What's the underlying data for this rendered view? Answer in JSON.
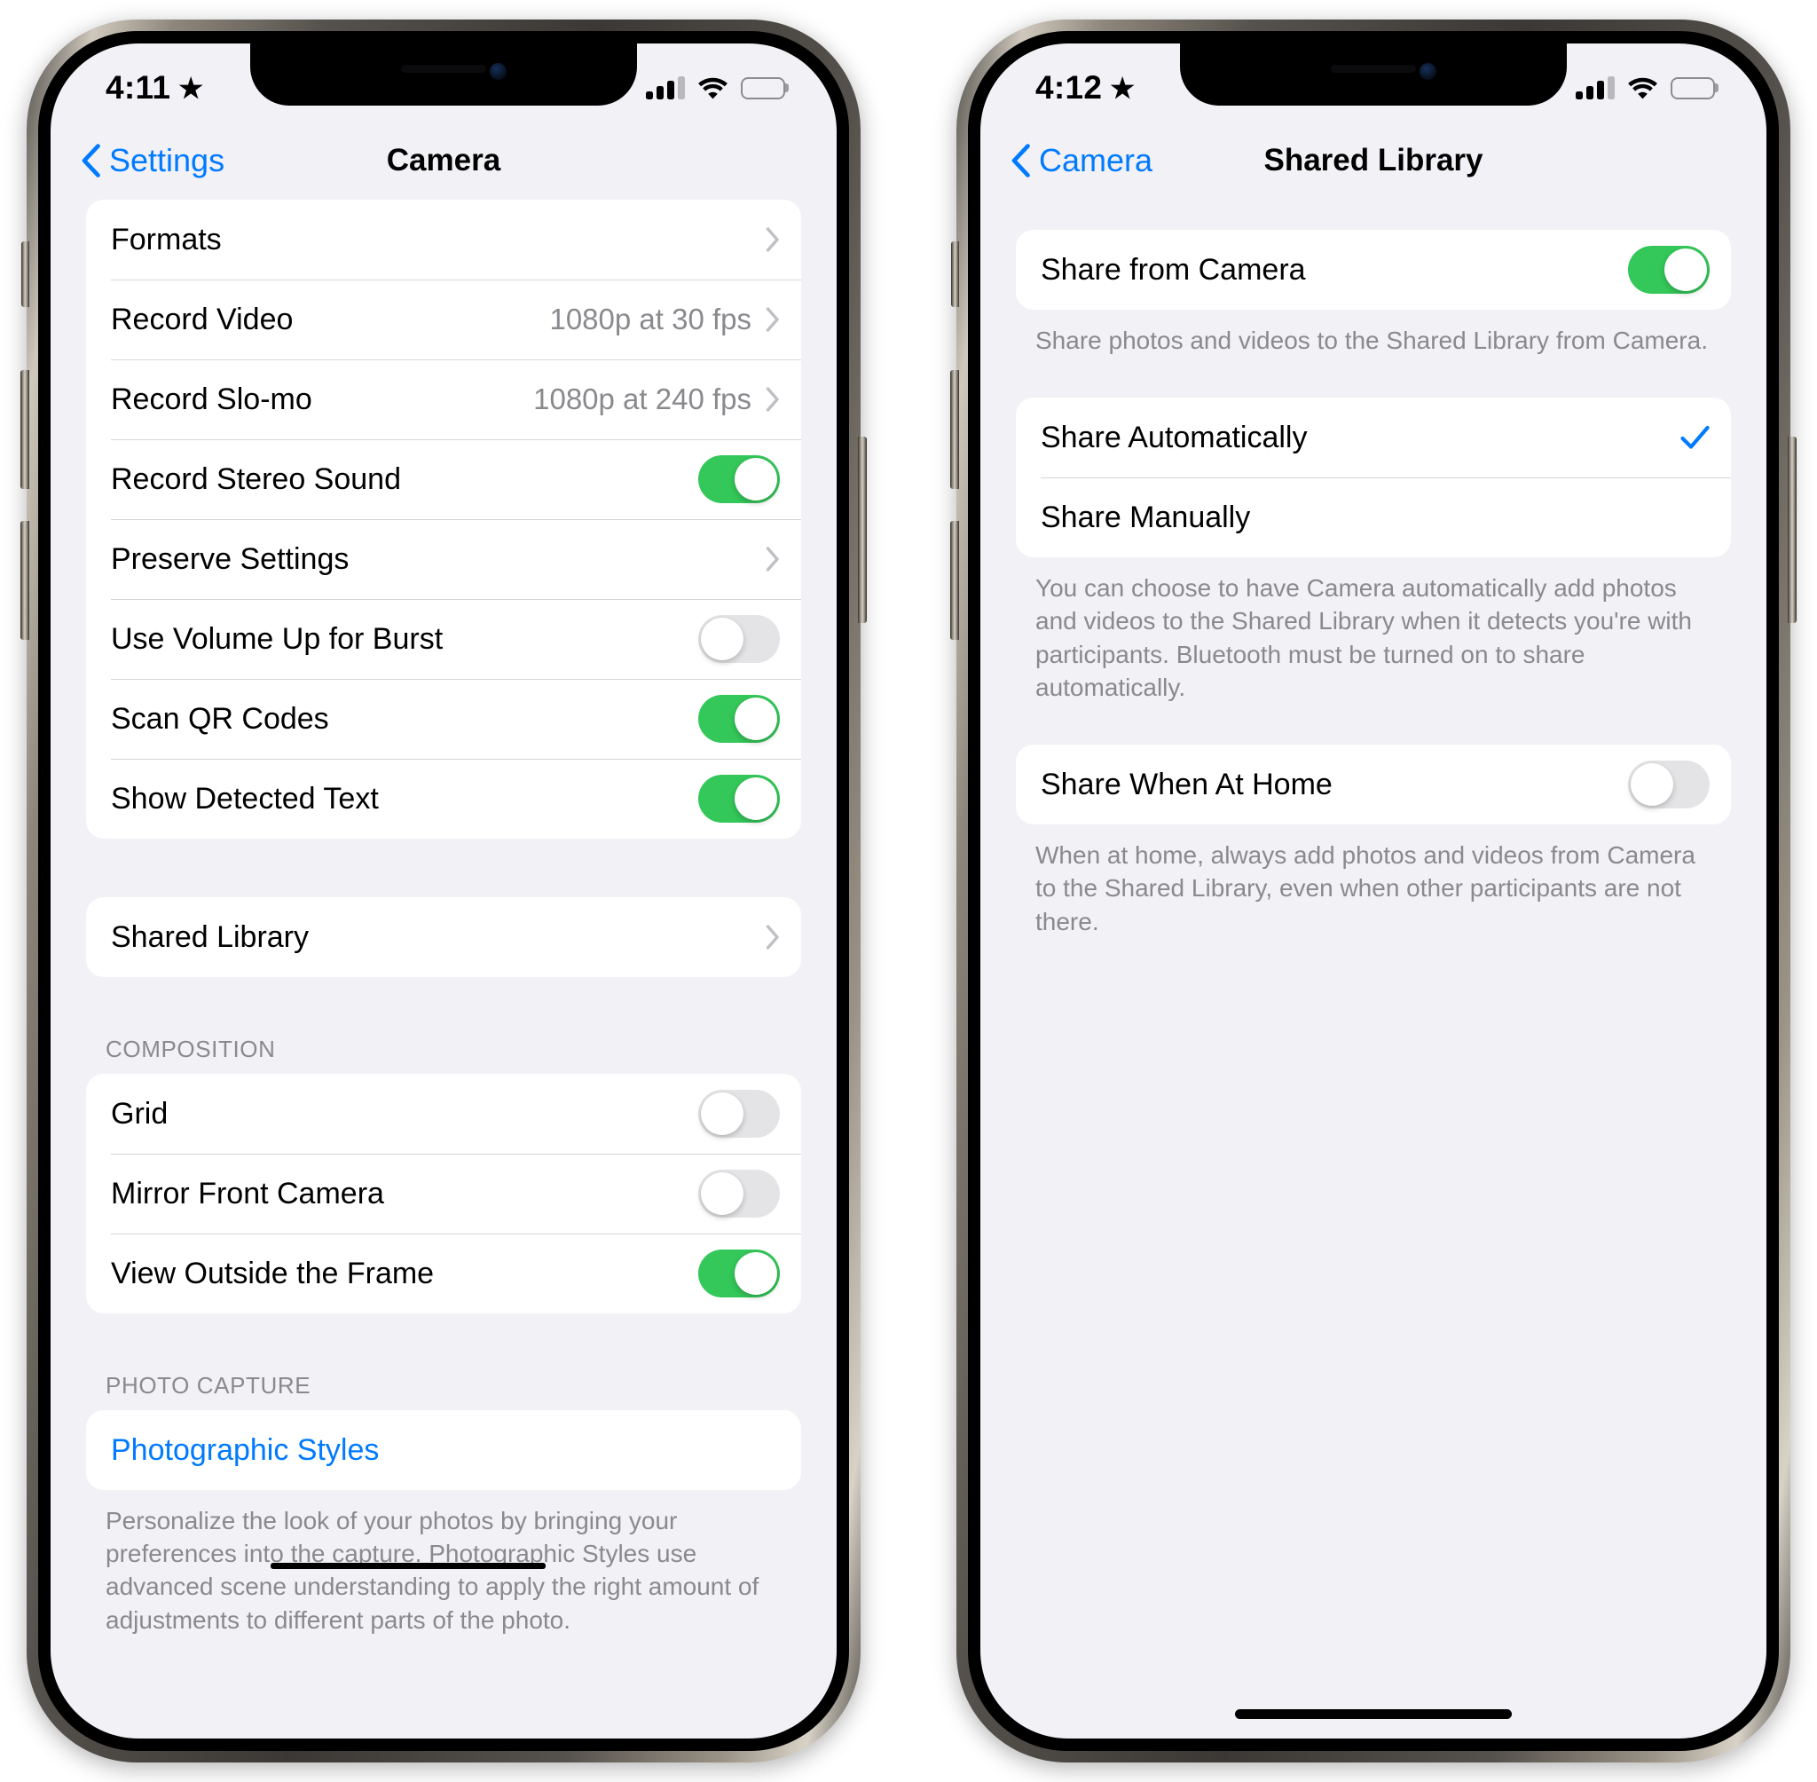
{
  "phones": [
    {
      "status": {
        "time": "4:11",
        "star_icon": "★",
        "signal_bars_filled": 3,
        "signal_bars_total": 4,
        "wifi_icon": "wifi-icon",
        "battery_icon": "battery-icon"
      },
      "nav": {
        "back_label": "Settings",
        "title": "Camera"
      },
      "sections": [
        {
          "header": "",
          "rows": [
            {
              "label": "Formats",
              "type": "disclosure",
              "value": ""
            },
            {
              "label": "Record Video",
              "type": "disclosure",
              "value": "1080p at 30 fps"
            },
            {
              "label": "Record Slo-mo",
              "type": "disclosure",
              "value": "1080p at 240 fps"
            },
            {
              "label": "Record Stereo Sound",
              "type": "toggle",
              "on": true
            },
            {
              "label": "Preserve Settings",
              "type": "disclosure",
              "value": ""
            },
            {
              "label": "Use Volume Up for Burst",
              "type": "toggle",
              "on": false
            },
            {
              "label": "Scan QR Codes",
              "type": "toggle",
              "on": true
            },
            {
              "label": "Show Detected Text",
              "type": "toggle",
              "on": true
            }
          ],
          "footnote": ""
        },
        {
          "header": "",
          "rows": [
            {
              "label": "Shared Library",
              "type": "disclosure",
              "value": ""
            }
          ],
          "footnote": ""
        },
        {
          "header": "COMPOSITION",
          "rows": [
            {
              "label": "Grid",
              "type": "toggle",
              "on": false
            },
            {
              "label": "Mirror Front Camera",
              "type": "toggle",
              "on": false
            },
            {
              "label": "View Outside the Frame",
              "type": "toggle",
              "on": true
            }
          ],
          "footnote": ""
        },
        {
          "header": "PHOTO CAPTURE",
          "rows": [
            {
              "label": "Photographic Styles",
              "type": "link",
              "value": ""
            }
          ],
          "footnote": "Personalize the look of your photos by bringing your preferences into the capture. Photographic Styles use advanced scene understanding to apply the right amount of adjustments to different parts of the photo."
        }
      ]
    },
    {
      "status": {
        "time": "4:12",
        "star_icon": "★",
        "signal_bars_filled": 3,
        "signal_bars_total": 4,
        "wifi_icon": "wifi-icon",
        "battery_icon": "battery-icon"
      },
      "nav": {
        "back_label": "Camera",
        "title": "Shared Library"
      },
      "sections": [
        {
          "header": "",
          "rows": [
            {
              "label": "Share from Camera",
              "type": "toggle",
              "on": true
            }
          ],
          "footnote": "Share photos and videos to the Shared Library from Camera."
        },
        {
          "header": "",
          "rows": [
            {
              "label": "Share Automatically",
              "type": "check",
              "checked": true
            },
            {
              "label": "Share Manually",
              "type": "check",
              "checked": false
            }
          ],
          "footnote": "You can choose to have Camera automatically add photos and videos to the Shared Library when it detects you're with participants. Bluetooth must be turned on to share automatically."
        },
        {
          "header": "",
          "rows": [
            {
              "label": "Share When At Home",
              "type": "toggle",
              "on": false
            }
          ],
          "footnote": "When at home, always add photos and videos from Camera to the Shared Library, even when other participants are not there."
        }
      ]
    }
  ],
  "colors": {
    "accent_blue": "#007aff",
    "toggle_on_green": "#34c759",
    "toggle_off_gray": "#e4e4e6",
    "screen_bg": "#f2f1f6",
    "row_bg": "#ffffff",
    "secondary_text": "#8a8a8e"
  }
}
